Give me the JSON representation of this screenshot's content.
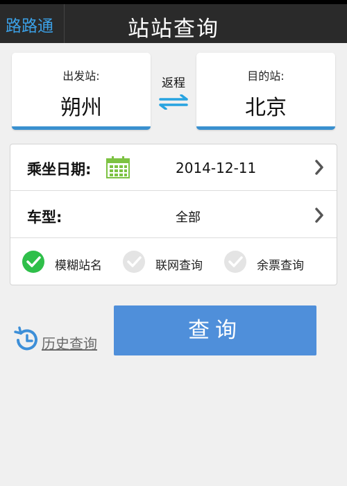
{
  "header": {
    "back_label": "路路通",
    "title": "站站查询"
  },
  "stations": {
    "from_label": "出发站:",
    "from_value": "朔州",
    "to_label": "目的站:",
    "to_value": "北京",
    "return_label": "返程"
  },
  "form": {
    "date_label": "乘坐日期:",
    "date_value": "2014-12-11",
    "type_label": "车型:",
    "type_value": "全部",
    "options": [
      {
        "label": "模糊站名",
        "checked": true
      },
      {
        "label": "联网查询",
        "checked": false
      },
      {
        "label": "余票查询",
        "checked": false
      }
    ]
  },
  "actions": {
    "history_label": "历史查询",
    "query_label": "查询"
  },
  "colors": {
    "accent_blue": "#4f8fda",
    "check_green": "#2fbf4a",
    "calendar_green": "#7dc242"
  }
}
